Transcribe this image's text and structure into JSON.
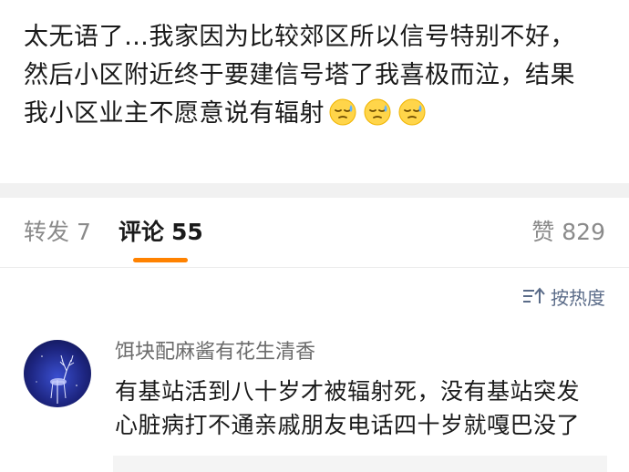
{
  "post": {
    "lines": [
      "太无语了…我家因为比较郊区所以信号特别不好，",
      "然后小区附近终于要建信号塔了我喜极而泣，结果",
      "我小区业主不愿意说有辐射"
    ],
    "emojis": [
      "sweat-face-icon",
      "sweat-face-icon",
      "sweat-face-icon"
    ]
  },
  "tabs": {
    "repost_label": "转发",
    "repost_count": "7",
    "comment_label": "评论",
    "comment_count": "55",
    "like_label": "赞",
    "like_count": "829",
    "active_color": "#ff8200"
  },
  "sort": {
    "label": "按热度",
    "icon": "sort-icon"
  },
  "comment": {
    "username": "饵块配麻酱有花生清香",
    "lines": [
      "有基站活到八十岁才被辐射死，没有基站突发",
      "心脏病打不通亲戚朋友电话四十岁就嘎巴没了"
    ],
    "avatar_icon": "deer-avatar"
  }
}
